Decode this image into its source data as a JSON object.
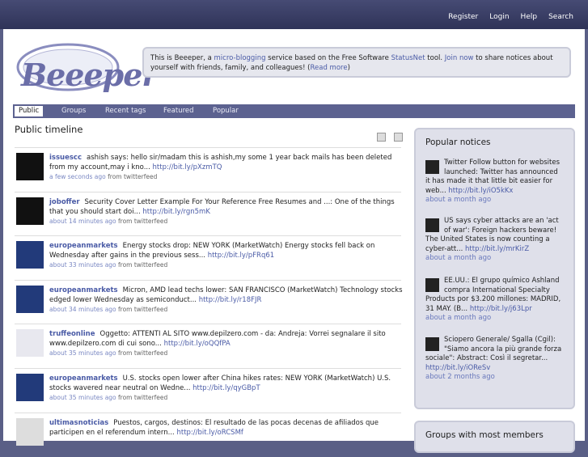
{
  "topnav": [
    "Register",
    "Login",
    "Help",
    "Search"
  ],
  "logo": {
    "text": "Beeeper"
  },
  "about": {
    "t1": "This is Beeeper, a ",
    "l1": "micro-blogging",
    "t2": " service based on the Free Software ",
    "l2": "StatusNet",
    "t3": " tool. ",
    "l3": "Join now",
    "t4": " to share notices about yourself with friends, family, and colleagues! (",
    "l4": "Read more",
    "t5": ")"
  },
  "tabs": [
    "Public",
    "Groups",
    "Recent tags",
    "Featured",
    "Popular"
  ],
  "timeline_title": "Public timeline",
  "notices": [
    {
      "nick": "issuescc",
      "text": "ashish says: hello sir/madam this is ashish,my some 1 year back mails has been deleted from my account,may i kno... ",
      "link": "http://bit.ly/pXzmTQ",
      "time": "a few seconds ago",
      "from": " from twitterfeed"
    },
    {
      "nick": "joboffer",
      "text": "Security Cover Letter Example For Your Reference Free Resumes and ...: One of the things that you should start doi... ",
      "link": "http://bit.ly/rgn5mK",
      "time": "about 14 minutes ago",
      "from": " from twitterfeed"
    },
    {
      "nick": "europeanmarkets",
      "text": "Energy stocks drop: NEW YORK (MarketWatch) Energy stocks fell back on Wednesday after gains in the previous sess... ",
      "link": "http://bit.ly/pFRq61",
      "time": "about 33 minutes ago",
      "from": " from twitterfeed"
    },
    {
      "nick": "europeanmarkets",
      "text": "Micron, AMD lead techs lower: SAN FRANCISCO (MarketWatch) Technology stocks edged lower Wednesday as semiconduct... ",
      "link": "http://bit.ly/r18FJR",
      "time": "about 34 minutes ago",
      "from": " from twitterfeed"
    },
    {
      "nick": "truffeonline",
      "text": "Oggetto: ATTENTI AL SITO www.depilzero.com - da: Andreja: Vorrei segnalare il sito www.depilzero.com di cui sono... ",
      "link": "http://bit.ly/oQQfPA",
      "time": "about 35 minutes ago",
      "from": " from twitterfeed"
    },
    {
      "nick": "europeanmarkets",
      "text": "U.S. stocks open lower after China hikes rates: NEW YORK (MarketWatch) U.S. stocks wavered near neutral on Wedne... ",
      "link": "http://bit.ly/qyGBpT",
      "time": "about 35 minutes ago",
      "from": " from twitterfeed"
    },
    {
      "nick": "ultimasnoticias",
      "text": "Puestos, cargos, destinos: El resultado de las pocas decenas de afiliados que participen en el referendum intern... ",
      "link": "http://bit.ly/oRCSMf",
      "time": "",
      "from": ""
    }
  ],
  "popular": {
    "title": "Popular notices",
    "items": [
      {
        "text": "Twitter Follow button for websites launched: Twitter has announced it has made it that little bit easier for web... ",
        "link": "http://bit.ly/iO5kKx",
        "when": "about a month ago"
      },
      {
        "text": "US says cyber attacks are an 'act of war': Foreign hackers beware! The United States is now counting a cyber-att... ",
        "link": "http://bit.ly/mrKirZ",
        "when": "about a month ago"
      },
      {
        "text": "EE.UU.: El grupo químico Ashland compra International Specialty Products por $3.200 millones: MADRID, 31 MAY. (B... ",
        "link": "http://bit.ly/j63Lpr",
        "when": "about a month ago"
      },
      {
        "text": "Sciopero Generale/ Sgalla (Cgil): \"Siamo ancora la più grande forza sociale\": Abstract: Così il segretar... ",
        "link": "http://bit.ly/iOReSv",
        "when": "about 2 months ago"
      }
    ]
  },
  "groups_box": {
    "title": "Groups with most members"
  }
}
